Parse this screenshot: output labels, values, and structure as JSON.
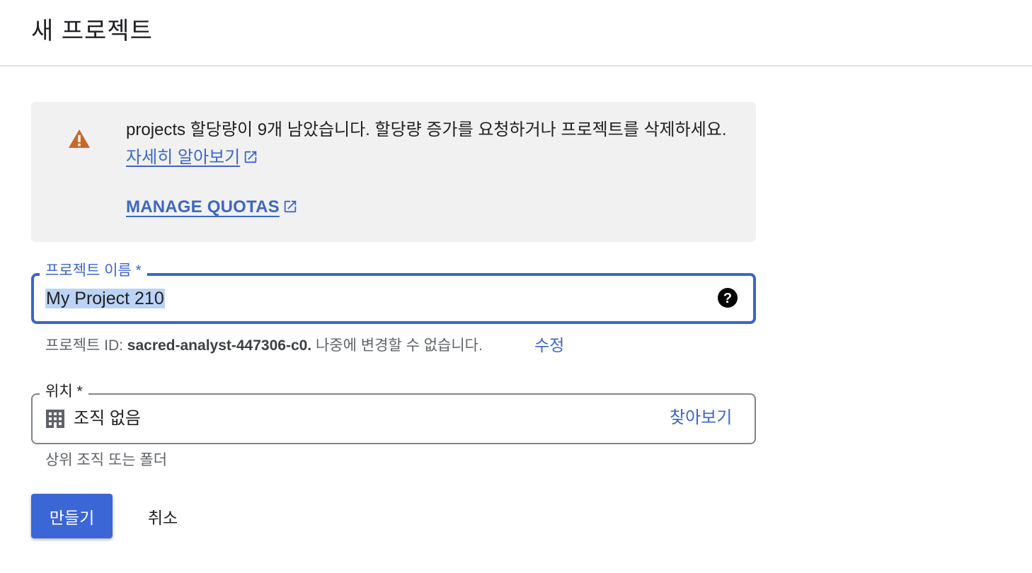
{
  "header": {
    "title": "새 프로젝트"
  },
  "quota_banner": {
    "message": "projects 할당량이 9개 남았습니다. 할당량 증가를 요청하거나 프로젝트를 삭제하세요.",
    "learn_more_label": "자세히 알아보기",
    "manage_quotas_label": "MANAGE QUOTAS",
    "icon": "warning-icon",
    "icon_color": "#c5692b"
  },
  "project_name": {
    "label": "프로젝트 이름 *",
    "value": "My Project 210",
    "help_icon": "help-circle-icon"
  },
  "project_id_hint": {
    "prefix": "프로젝트 ID:",
    "id": "sacred-analyst-447306-c0.",
    "suffix": "나중에 변경할 수 없습니다.",
    "edit_label": "수정"
  },
  "location": {
    "label": "위치 *",
    "value": "조직 없음",
    "browse_label": "찾아보기",
    "icon": "building-icon",
    "hint": "상위 조직 또는 폴더"
  },
  "actions": {
    "create_label": "만들기",
    "cancel_label": "취소"
  },
  "colors": {
    "accent": "#3b66c8",
    "primary_button": "#3b66d6",
    "banner_bg": "#f1f1f1",
    "selection": "#bcd3f6"
  }
}
